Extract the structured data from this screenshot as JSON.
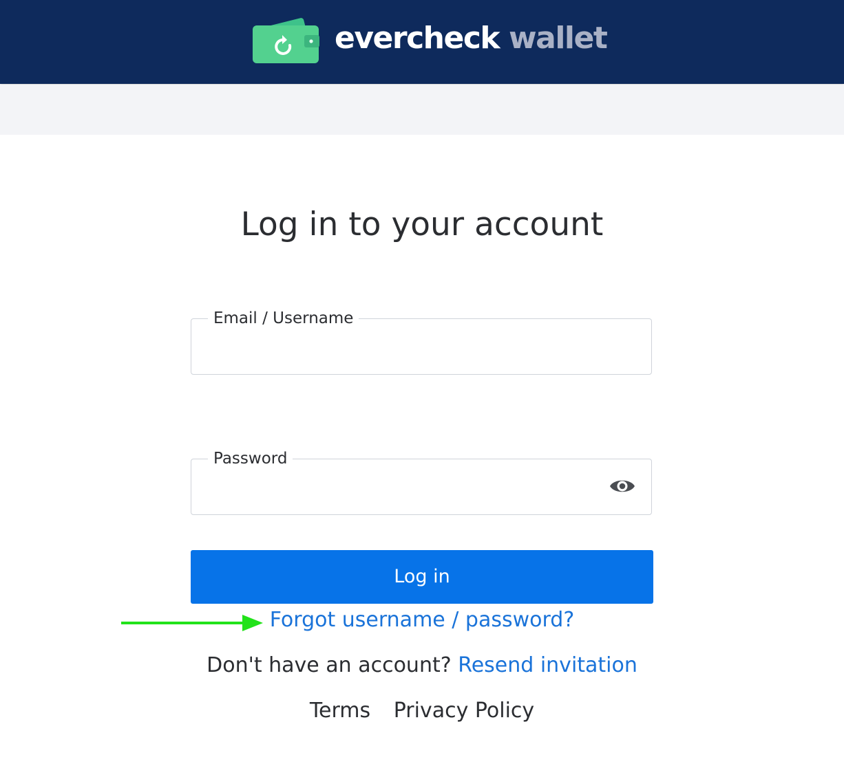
{
  "header": {
    "brand_primary": "evercheck",
    "brand_secondary": "wallet",
    "logo_icon": "wallet-refresh-icon",
    "background_color": "#0e2a5c",
    "logo_color": "#3ec28a"
  },
  "login": {
    "title": "Log in to your account",
    "email": {
      "label": "Email / Username",
      "value": ""
    },
    "password": {
      "label": "Password",
      "value": "",
      "toggle_icon": "eye-icon"
    },
    "submit_label": "Log in",
    "submit_color": "#0773e8",
    "forgot_link": "Forgot username / password?",
    "signup_prompt": "Don't have an account?",
    "resend_link": "Resend invitation"
  },
  "annotation": {
    "arrow_icon": "green-arrow-right-icon",
    "arrow_color": "#22e21a"
  },
  "footer": {
    "links": [
      "Terms",
      "Privacy Policy"
    ]
  },
  "colors": {
    "link": "#1a73d9",
    "text": "#2b2d31",
    "subbar": "#f3f4f7"
  }
}
